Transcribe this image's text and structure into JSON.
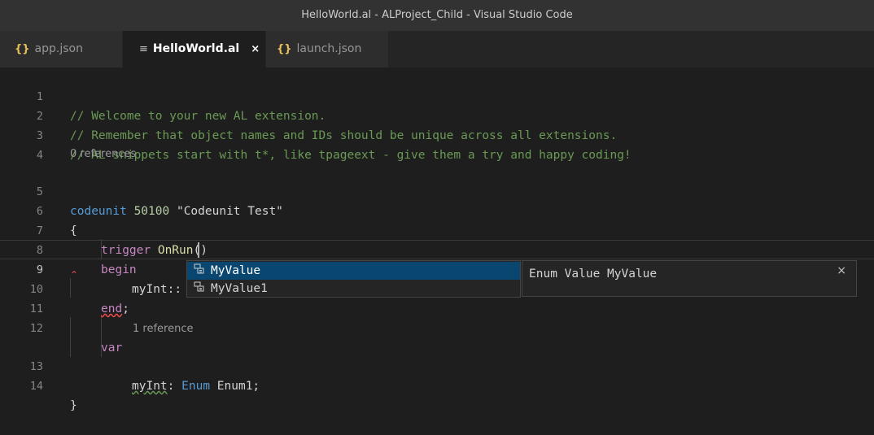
{
  "window": {
    "title": "HelloWorld.al - ALProject_Child - Visual Studio Code"
  },
  "tabs": [
    {
      "icon": "{}",
      "label": "app.json"
    },
    {
      "icon": "≡",
      "label": "HelloWorld.al",
      "close": "×"
    },
    {
      "icon": "{}",
      "label": "launch.json"
    }
  ],
  "editor": {
    "line_numbers": [
      "1",
      "2",
      "3",
      "4",
      "5",
      "6",
      "7",
      "8",
      "9",
      "10",
      "11",
      "12",
      "13",
      "14"
    ],
    "code_lens": [
      "0 references",
      "1 reference"
    ],
    "lines": {
      "l1": "// Welcome to your new AL extension.",
      "l2": "// Remember that object names and IDs should be unique across all extensions.",
      "l3": "// AL snippets start with t*, like tpageext - give them a try and happy coding!",
      "l5": {
        "kw": "codeunit",
        "num": "50100",
        "str": "\"Codeunit Test\""
      },
      "l6": "{",
      "l7": {
        "kw": "trigger",
        "fn": "OnRun",
        "paren": "()"
      },
      "l8": "begin",
      "l9": "myInt::",
      "l10": {
        "kw": "end",
        "semi": ";"
      },
      "l12": "var",
      "l13": {
        "name": "myInt",
        "colon": ": ",
        "type": "Enum",
        "rest": " Enum1;"
      },
      "l14": "}"
    }
  },
  "suggest": {
    "items": [
      {
        "label": "MyValue",
        "icon": "enum-member-icon"
      },
      {
        "label": "MyValue1",
        "icon": "enum-member-icon"
      }
    ],
    "details": "Enum Value MyValue",
    "details_close": "×"
  },
  "colors": {
    "editor_bg": "#1e1e1e",
    "comment": "#6a9955",
    "keyword": "#c586c0",
    "keyword_blue": "#569cd6",
    "number": "#b5cea8",
    "string": "#ce9178",
    "function": "#dcdcaa",
    "selection": "#094771"
  }
}
